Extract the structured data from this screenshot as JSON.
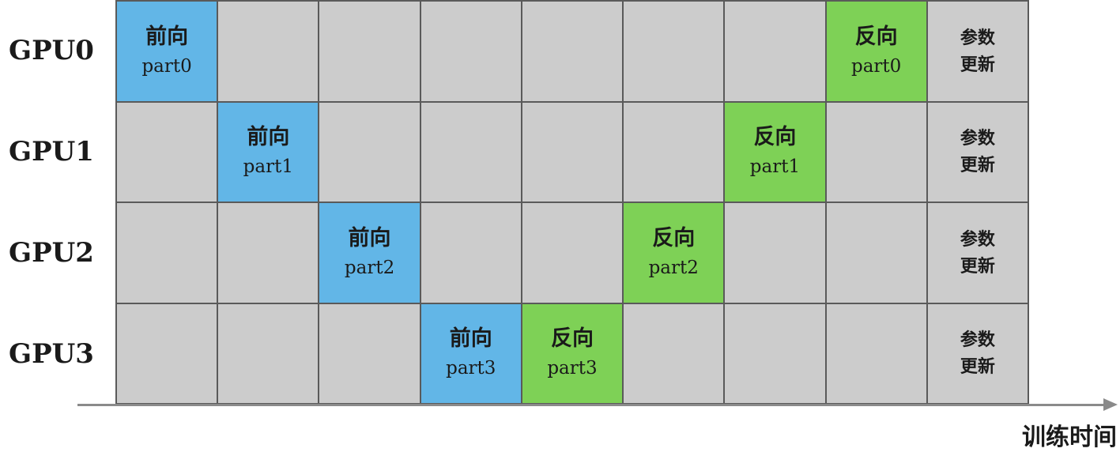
{
  "rows": [
    {
      "label": "GPU0",
      "cells": [
        {
          "kind": "forward",
          "l1": "前向",
          "l2": "part0"
        },
        {
          "kind": "empty"
        },
        {
          "kind": "empty"
        },
        {
          "kind": "empty"
        },
        {
          "kind": "empty"
        },
        {
          "kind": "empty"
        },
        {
          "kind": "empty"
        },
        {
          "kind": "backward",
          "l1": "反向",
          "l2": "part0"
        },
        {
          "kind": "update",
          "l1": "参数",
          "l2": "更新"
        }
      ]
    },
    {
      "label": "GPU1",
      "cells": [
        {
          "kind": "empty"
        },
        {
          "kind": "forward",
          "l1": "前向",
          "l2": "part1"
        },
        {
          "kind": "empty"
        },
        {
          "kind": "empty"
        },
        {
          "kind": "empty"
        },
        {
          "kind": "empty"
        },
        {
          "kind": "backward",
          "l1": "反向",
          "l2": "part1"
        },
        {
          "kind": "empty"
        },
        {
          "kind": "update",
          "l1": "参数",
          "l2": "更新"
        }
      ]
    },
    {
      "label": "GPU2",
      "cells": [
        {
          "kind": "empty"
        },
        {
          "kind": "empty"
        },
        {
          "kind": "forward",
          "l1": "前向",
          "l2": "part2"
        },
        {
          "kind": "empty"
        },
        {
          "kind": "empty"
        },
        {
          "kind": "backward",
          "l1": "反向",
          "l2": "part2"
        },
        {
          "kind": "empty"
        },
        {
          "kind": "empty"
        },
        {
          "kind": "update",
          "l1": "参数",
          "l2": "更新"
        }
      ]
    },
    {
      "label": "GPU3",
      "cells": [
        {
          "kind": "empty"
        },
        {
          "kind": "empty"
        },
        {
          "kind": "empty"
        },
        {
          "kind": "forward",
          "l1": "前向",
          "l2": "part3"
        },
        {
          "kind": "backward",
          "l1": "反向",
          "l2": "part3"
        },
        {
          "kind": "empty"
        },
        {
          "kind": "empty"
        },
        {
          "kind": "empty"
        },
        {
          "kind": "update",
          "l1": "参数",
          "l2": "更新"
        }
      ]
    }
  ],
  "axis_label": "训练时间",
  "colors": {
    "forward": "#62b6e7",
    "backward": "#7ed156",
    "idle": "#cccccc",
    "border": "#5a5a5a",
    "axis": "#8a8a8a"
  }
}
